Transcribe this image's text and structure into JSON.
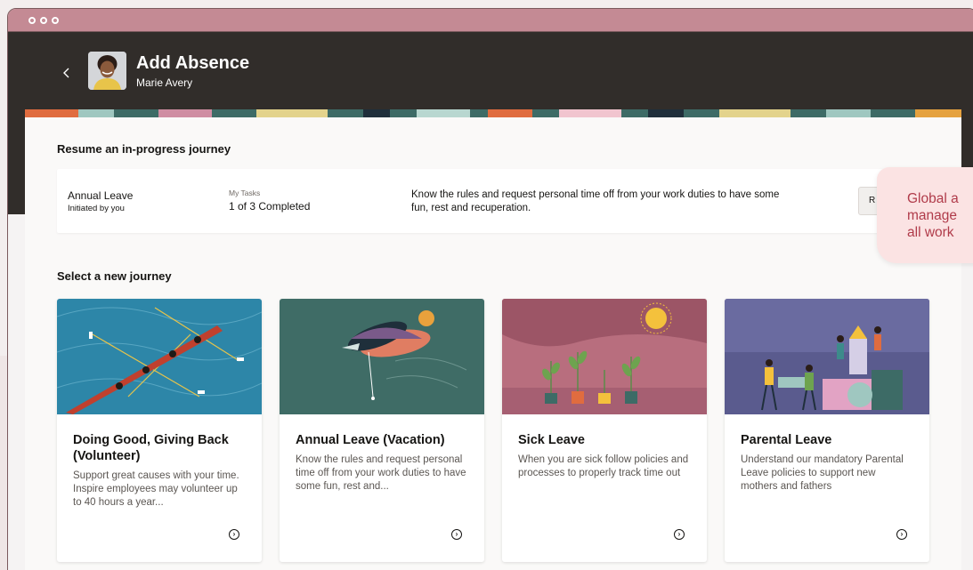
{
  "header": {
    "title": "Add Absence",
    "subtitle": "Marie Avery"
  },
  "resume_section": {
    "title": "Resume an in-progress journey",
    "journey": {
      "name": "Annual Leave",
      "initiated": "Initiated by you",
      "tasks_label": "My Tasks",
      "tasks_value": "1 of 3 Completed",
      "description": "Know the rules and request personal time off from your work duties to have some fun, rest and recuperation.",
      "button_label": "R"
    }
  },
  "tooltip": {
    "line1": "Global a",
    "line2": "manage",
    "line3": "all work"
  },
  "new_section": {
    "title": "Select a new journey",
    "cards": [
      {
        "title": "Doing Good, Giving Back (Volunteer)",
        "description": "Support great causes with your time. Inspire employees may volunteer up to 40 hours a year..."
      },
      {
        "title": "Annual Leave (Vacation)",
        "description": "Know the rules and request personal time off from your work duties to have some fun, rest and..."
      },
      {
        "title": "Sick Leave",
        "description": "When you are sick follow policies and processes to properly track time out"
      },
      {
        "title": "Parental Leave",
        "description": "Understand our mandatory Parental Leave policies to support new mothers and fathers"
      }
    ]
  },
  "icons": {
    "back": "chevron-left-icon",
    "arrow": "arrow-circle-right-icon"
  },
  "colors": {
    "titlebar": "#c48a94",
    "appbar": "#312d2a",
    "tooltip_text": "#b03b4a",
    "tooltip_bg": "#fbe3e3"
  }
}
